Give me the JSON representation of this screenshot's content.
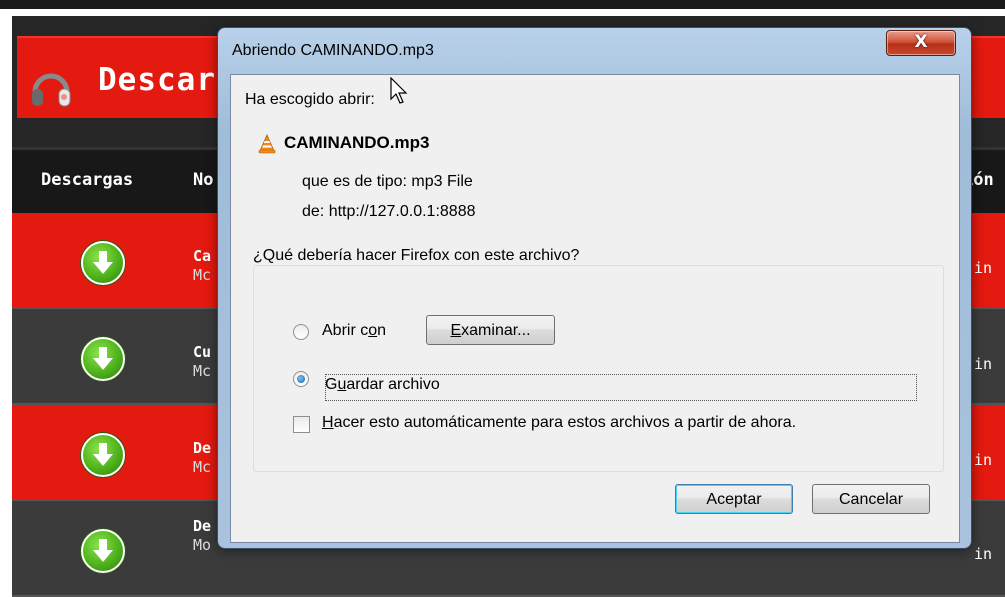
{
  "background": {
    "site_title": "Descar",
    "columns": {
      "downloads": "Descargas",
      "name": "No",
      "right": "ión"
    },
    "rows": [
      {
        "line1": "Ca",
        "line2": "Mc",
        "right": "in"
      },
      {
        "line1": "Cu",
        "line2": "Mc",
        "right": "in"
      },
      {
        "line1": "De",
        "line2": "Mc",
        "right": "in"
      },
      {
        "line1": "De",
        "line2": "Mo",
        "right": "in"
      }
    ],
    "colors": {
      "accent": "#e4190f",
      "dark": "#262626",
      "download": "#4fb31c"
    }
  },
  "dialog": {
    "title": "Abriendo CAMINANDO.mp3",
    "close_label": "X",
    "intro": "Ha escogido abrir:",
    "file": {
      "name": "CAMINANDO.mp3",
      "icon": "vlc-cone-icon",
      "type_label": "que es de tipo:",
      "type_value": "mp3 File",
      "from_label": "de:",
      "from_value": "http://127.0.0.1:8888"
    },
    "question": "¿Qué debería hacer Firefox con este archivo?",
    "open_with": {
      "pre": "Abrir c",
      "key": "o",
      "post": "n",
      "selected": false
    },
    "browse": {
      "key": "E",
      "post": "xaminar..."
    },
    "save": {
      "pre": "G",
      "key": "u",
      "post": "ardar archivo",
      "selected": true
    },
    "auto": {
      "key": "H",
      "post": "acer esto automáticamente para estos archivos a partir de ahora.",
      "checked": false
    },
    "ok_label": "Aceptar",
    "cancel_label": "Cancelar"
  }
}
